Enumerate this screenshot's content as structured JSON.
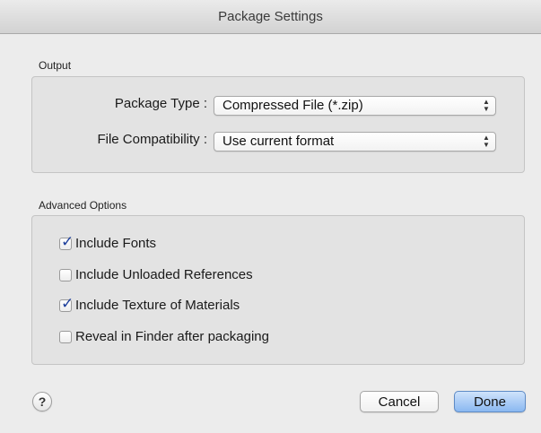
{
  "window": {
    "title": "Package Settings"
  },
  "output": {
    "section_label": "Output",
    "package_type": {
      "label": "Package Type :",
      "value": "Compressed File (*.zip)"
    },
    "file_compatibility": {
      "label": "File Compatibility :",
      "value": "Use current format"
    }
  },
  "advanced": {
    "section_label": "Advanced Options",
    "options": [
      {
        "label": "Include Fonts",
        "checked": true
      },
      {
        "label": "Include Unloaded References",
        "checked": false
      },
      {
        "label": "Include Texture of Materials",
        "checked": true
      },
      {
        "label": "Reveal in Finder after packaging",
        "checked": false
      }
    ]
  },
  "footer": {
    "help_label": "?",
    "cancel_label": "Cancel",
    "done_label": "Done"
  },
  "icons": {
    "checkmark": "checkmark-icon",
    "updown": "updown-arrows-icon",
    "help": "help-icon"
  },
  "colors": {
    "default_button": "#8ab8f1",
    "checkmark": "#1d3f9c"
  }
}
